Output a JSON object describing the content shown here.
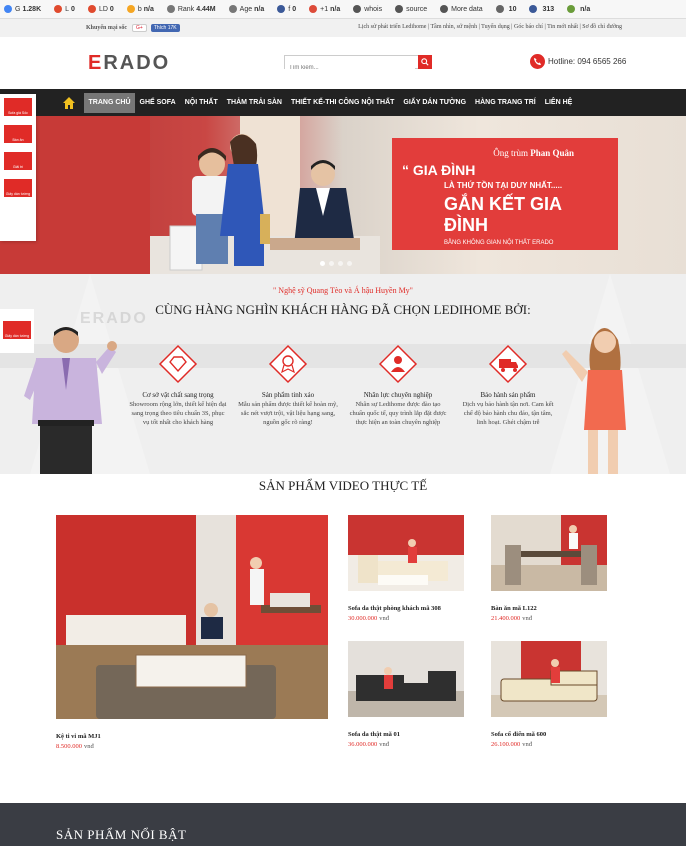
{
  "seobar": {
    "items": [
      {
        "label": "G",
        "value": "1.28K",
        "color": "#4285f4"
      },
      {
        "label": "L",
        "value": "0",
        "color": "#e04a2e"
      },
      {
        "label": "LD",
        "value": "0",
        "color": "#e04a2e"
      },
      {
        "label": "b",
        "value": "n/a",
        "color": "#f5a623"
      },
      {
        "label": "Rank",
        "value": "4.44M",
        "color": "#777777"
      },
      {
        "label": "Age",
        "value": "n/a",
        "color": "#777777"
      },
      {
        "label": "f",
        "value": "0",
        "color": "#3b5998"
      },
      {
        "label": "+1",
        "value": "n/a",
        "color": "#dd4b39"
      },
      {
        "label": "whois",
        "value": "",
        "color": "#555555"
      },
      {
        "label": "source",
        "value": "",
        "color": "#555555"
      },
      {
        "label": "More data",
        "value": "",
        "color": "#555555"
      },
      {
        "label": "",
        "value": "10",
        "color": "#666666"
      },
      {
        "label": "",
        "value": "313",
        "color": "#3b5998"
      },
      {
        "label": "",
        "value": "n/a",
        "color": "#6a9c3a"
      }
    ]
  },
  "topstrip": {
    "promo": "Khuyến mại sốc",
    "gplus": "G+",
    "fb_like": "Thích 17K",
    "links": "Lịch sử phát triển Ledihome | Tầm nhìn, sứ mệnh | Tuyển dụng | Góc báo chí | Tin mới nhất | Sơ đồ chỉ đường"
  },
  "header": {
    "logo_e": "E",
    "logo_rest": "RADO",
    "search_placeholder": "Tìm kiếm...",
    "hotline": "Hotline: 094 6565 266"
  },
  "nav": {
    "items": [
      "TRANG CHỦ",
      "GHẾ SOFA",
      "NỘI THẤT",
      "THẢM TRẢI SÀN",
      "THIẾT KẾ-THI CÔNG NỘI THẤT",
      "GIẤY DÁN TƯỜNG",
      "HÀNG TRANG TRÍ",
      "LIÊN HỆ"
    ]
  },
  "left_float": {
    "items": [
      "Sofa giá Sốc",
      "Bàn ăn",
      "Giải trí",
      "Giấy dán tường"
    ]
  },
  "hero": {
    "tag_prefix": "Ông trùm",
    "tag_name": "Phan Quân",
    "line1": "“ GIA ĐÌNH",
    "line2": "LÀ THỨ TỒN TẠI DUY NHẤT.....",
    "line3": "GẮN KẾT GIA ĐÌNH",
    "line4": "BẰNG KHÔNG GIAN NỘI THẤT ERADO"
  },
  "partners": {
    "quote": "\" Nghệ sỹ Quang Tèo và Á hậu Huyền My\"",
    "title": "CÙNG HÀNG NGHÌN KHÁCH HÀNG ĐÃ CHỌN LEDIHOME BỞI:",
    "features": [
      {
        "title": "Cơ sở vật chất sang trọng",
        "desc": "Showroom rộng lớn, thiết kế hiện đại sang trọng theo tiêu chuẩn 3S, phục vụ tốt nhất cho khách hàng"
      },
      {
        "title": "Sản phẩm tinh xảo",
        "desc": "Mẫu sản phẩm được thiết kế hoàn mỹ, sắc nét vượt trội, vật liệu hạng sang, nguồn gốc rõ ràng!"
      },
      {
        "title": "Nhân lực chuyên nghiệp",
        "desc": "Nhân sự Ledihome được đào tạo chuẩn quốc tế, quy trình lắp đặt được thực hiện an toàn chuyên nghiệp"
      },
      {
        "title": "Bảo hành sản phẩm",
        "desc": "Dịch vụ bảo hành tận nơi. Cam kết chế độ bảo hành chu đáo, tận tâm, linh hoạt. Ghét chậm trễ"
      }
    ]
  },
  "video": {
    "title": "SẢN PHẨM VIDEO THỰC TẾ",
    "currency": "vnđ",
    "products": [
      {
        "name": "Kệ ti vi mã MJ1",
        "price": "8.500.000"
      },
      {
        "name": "Sofa da thật phòng khách mã 308",
        "price": "30.000.000"
      },
      {
        "name": "Bàn ăn mã L122",
        "price": "21.400.000"
      },
      {
        "name": "Sofa da thật mã 01",
        "price": "36.000.000"
      },
      {
        "name": "Sofa cổ điển mã 600",
        "price": "26.100.000"
      }
    ]
  },
  "featured": {
    "title": "SẢN PHẨM NỔI BẬT"
  }
}
